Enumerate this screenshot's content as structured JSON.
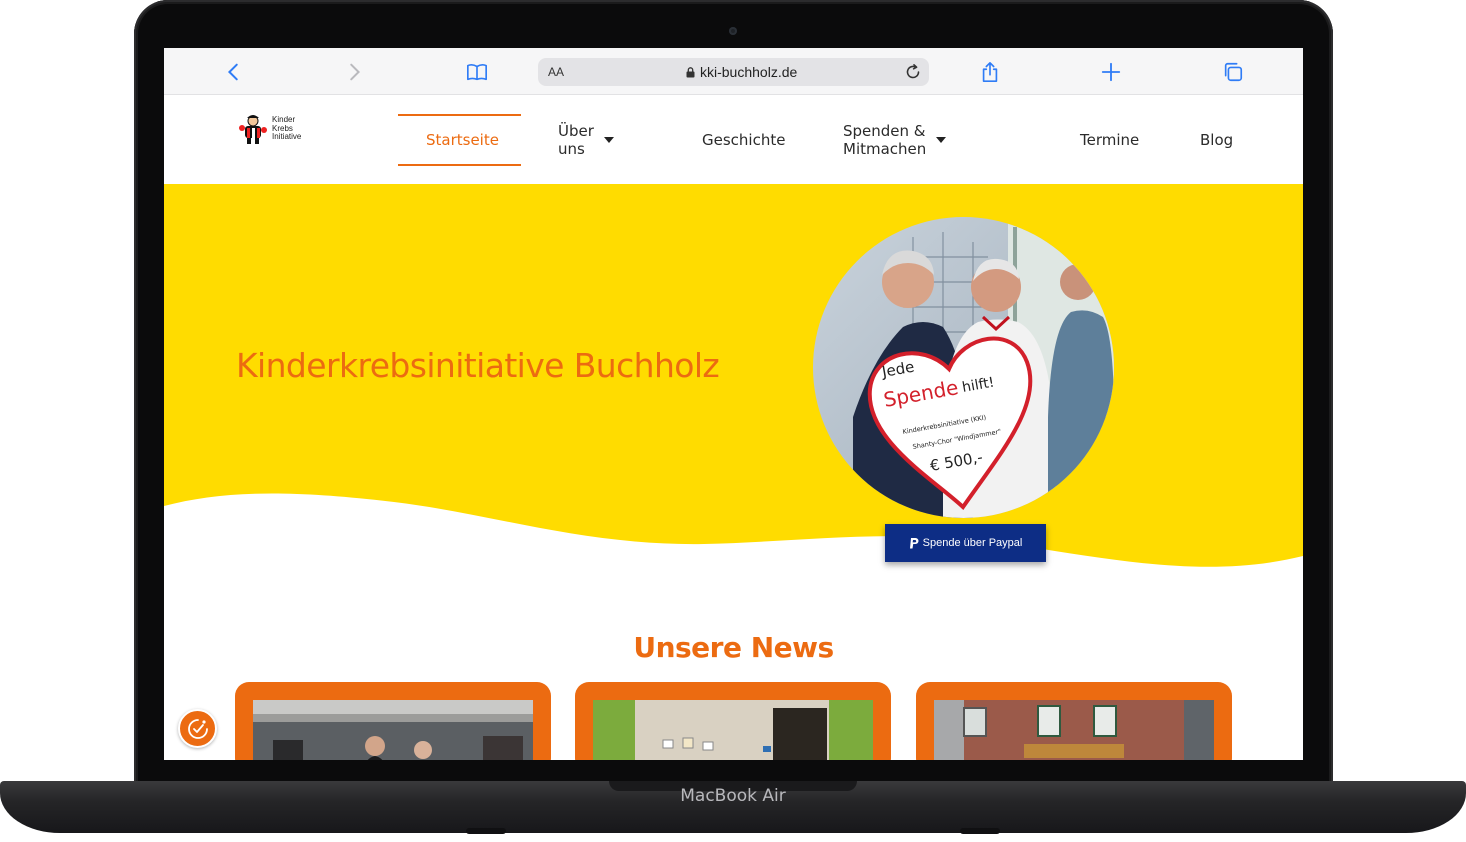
{
  "device": {
    "label": "MacBook Air"
  },
  "browser": {
    "text_size_label": "AA",
    "url": "kki-buchholz.de"
  },
  "site": {
    "logo_lines": [
      "Kinder",
      "Krebs",
      "Initiative"
    ],
    "nav": [
      {
        "label": "Startseite",
        "active": true
      },
      {
        "label": "Über uns",
        "dropdown": true
      },
      {
        "label": "Geschichte"
      },
      {
        "label": "Spenden & Mitmachen",
        "dropdown": true
      },
      {
        "label": "Termine"
      },
      {
        "label": "Blog"
      }
    ],
    "hero_title": "Kinderkrebsinitiative Buchholz",
    "photo_sign": {
      "line1": "Jede",
      "line2": "Spende",
      "line3": "hilft!",
      "line4": "Kinderkrebsinitiative (KKI)",
      "line5": "Shanty-Chor \"Windjammer\"",
      "amount": "€ 500,-"
    },
    "paypal_label": "Spende über Paypal",
    "news_heading": "Unsere News"
  },
  "colors": {
    "accent": "#ec6b11",
    "hero_yellow": "#ffdc00",
    "paypal_blue": "#0d2d85"
  }
}
